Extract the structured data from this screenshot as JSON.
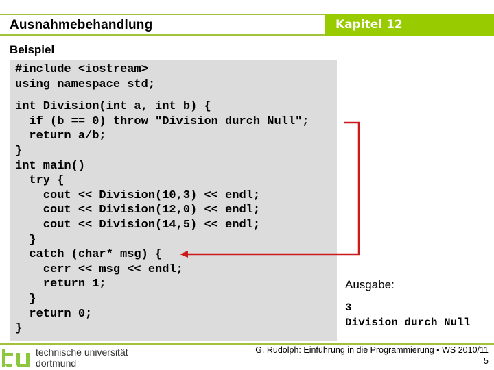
{
  "header": {
    "title": "Ausnahmebehandlung",
    "chapter": "Kapitel 12",
    "accent_color": "#99cc00"
  },
  "section": {
    "title": "Beispiel"
  },
  "code": {
    "lines": [
      "#include <iostream>",
      "using namespace std;",
      "int Division(int a, int b) {",
      "  if (b == 0) throw \"Division durch Null\";",
      "  return a/b;",
      "}",
      "int main()",
      "  try {",
      "    cout << Division(10,3) << endl;",
      "    cout << Division(12,0) << endl;",
      "    cout << Division(14,5) << endl;",
      "  }",
      "  catch (char* msg) {",
      "    cerr << msg << endl;",
      "    return 1;",
      "  }",
      "  return 0;",
      "}"
    ]
  },
  "annotation": {
    "arrow_color": "#cc0000",
    "arrow_from": "throw statement",
    "arrow_to": "catch block"
  },
  "output": {
    "label": "Ausgabe:",
    "lines": [
      "3",
      "Division durch Null"
    ]
  },
  "footer": {
    "logo_line1": "technische universität",
    "logo_line2": "dortmund",
    "credit": "G. Rudolph: Einführung in die Programmierung ▪ WS 2010/11",
    "page": "5"
  }
}
